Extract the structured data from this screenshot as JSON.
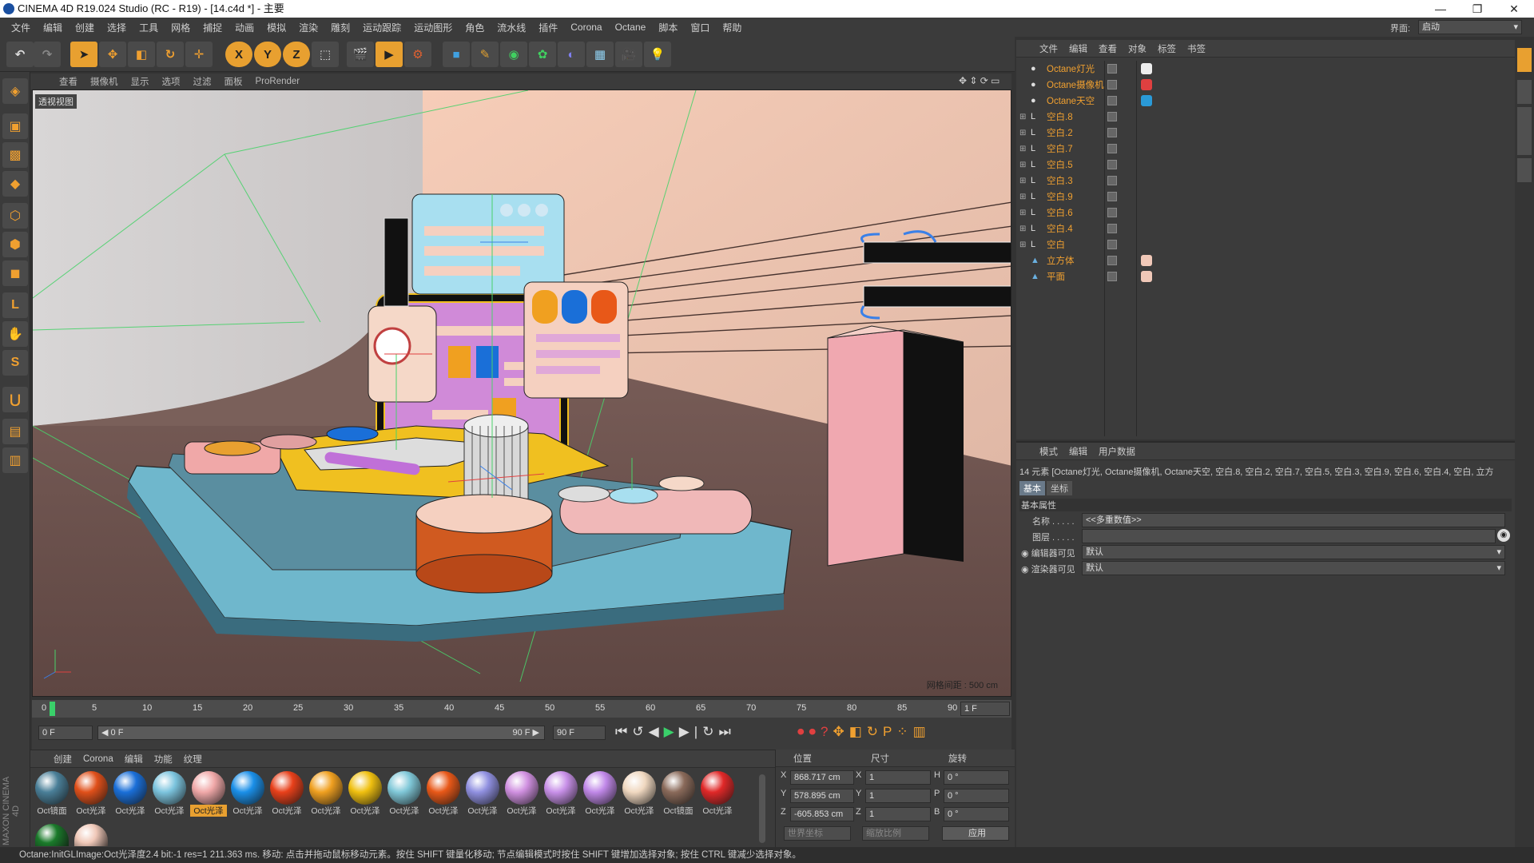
{
  "window": {
    "title": "CINEMA 4D R19.024 Studio (RC - R19) - [14.c4d *] - 主要",
    "controls": [
      "—",
      "❐",
      "✕"
    ]
  },
  "menu": [
    "文件",
    "编辑",
    "创建",
    "选择",
    "工具",
    "网格",
    "捕捉",
    "动画",
    "模拟",
    "渲染",
    "雕刻",
    "运动跟踪",
    "运动图形",
    "角色",
    "流水线",
    "插件",
    "Corona",
    "Octane",
    "脚本",
    "窗口",
    "帮助"
  ],
  "layout": {
    "label": "界面:",
    "value": "启动"
  },
  "viewport": {
    "menu": [
      "查看",
      "摄像机",
      "显示",
      "选项",
      "过滤",
      "面板",
      "ProRender"
    ],
    "label": "透视视图",
    "grid_text": "网格间距 : 500 cm"
  },
  "timeline": {
    "ticks": [
      "0",
      "5",
      "10",
      "15",
      "20",
      "25",
      "30",
      "35",
      "40",
      "45",
      "50",
      "55",
      "60",
      "65",
      "70",
      "75",
      "80",
      "85",
      "90"
    ],
    "current": "1 F",
    "start": "0 F",
    "range_start": "◀ 0 F",
    "range_end": "90 F ▶",
    "end": "90 F"
  },
  "objects": {
    "menu": [
      "文件",
      "编辑",
      "查看",
      "对象",
      "标签",
      "书签"
    ],
    "items": [
      {
        "name": "Octane灯光"
      },
      {
        "name": "Octane摄像机"
      },
      {
        "name": "Octane天空"
      },
      {
        "name": "空白.8"
      },
      {
        "name": "空白.2"
      },
      {
        "name": "空白.7"
      },
      {
        "name": "空白.5"
      },
      {
        "name": "空白.3"
      },
      {
        "name": "空白.9"
      },
      {
        "name": "空白.6"
      },
      {
        "name": "空白.4"
      },
      {
        "name": "空白"
      },
      {
        "name": "立方体"
      },
      {
        "name": "平面"
      }
    ]
  },
  "attributes": {
    "menu": [
      "模式",
      "编辑",
      "用户数据"
    ],
    "summary": "14 元素 [Octane灯光, Octane摄像机, Octane天空, 空白.8, 空白.2, 空白.7, 空白.5, 空白.3, 空白.9, 空白.6, 空白.4, 空白, 立方",
    "tabs": [
      "基本",
      "坐标"
    ],
    "section": "基本属性",
    "name_label": "名称 . . . . .",
    "name_value": "<<多重数值>>",
    "layer_label": "图层 . . . . .",
    "editor_vis_label": "编辑器可见",
    "editor_vis_value": "默认",
    "render_vis_label": "渲染器可见",
    "render_vis_value": "默认"
  },
  "materials": {
    "menu": [
      "创建",
      "Corona",
      "编辑",
      "功能",
      "纹理"
    ],
    "items": [
      {
        "label": "Oct镜面",
        "color": "#4a7f98"
      },
      {
        "label": "Oct光泽",
        "color": "#e0501a"
      },
      {
        "label": "Oct光泽",
        "color": "#1a6fd8"
      },
      {
        "label": "Oct光泽",
        "color": "#7cc4de"
      },
      {
        "label": "Oct光泽",
        "color": "#f0a8a8"
      },
      {
        "label": "Oct光泽",
        "color": "#1a8fe8"
      },
      {
        "label": "Oct光泽",
        "color": "#e8401a"
      },
      {
        "label": "Oct光泽",
        "color": "#f0a020"
      },
      {
        "label": "Oct光泽",
        "color": "#f0c010"
      },
      {
        "label": "Oct光泽",
        "color": "#80c8d8"
      },
      {
        "label": "Oct光泽",
        "color": "#e85818"
      },
      {
        "label": "Oct光泽",
        "color": "#9090e0"
      },
      {
        "label": "Oct光泽",
        "color": "#d090e0"
      },
      {
        "label": "Oct光泽",
        "color": "#c890e8"
      },
      {
        "label": "Oct光泽",
        "color": "#c088e8"
      },
      {
        "label": "Oct光泽",
        "color": "#f0d8c0"
      },
      {
        "label": "Oct镜面",
        "color": "#8a6a5a"
      },
      {
        "label": "Oct光泽",
        "color": "#e02828"
      }
    ],
    "row2": [
      {
        "color": "#1a7a2a"
      },
      {
        "color": "#f0c8b8"
      }
    ]
  },
  "coords": {
    "headers": [
      "位置",
      "尺寸",
      "旋转"
    ],
    "rows": [
      {
        "axis": "X",
        "pos": "868.717 cm",
        "size_axis": "X",
        "size": "1",
        "rot_axis": "H",
        "rot": "0 °"
      },
      {
        "axis": "Y",
        "pos": "578.895 cm",
        "size_axis": "Y",
        "size": "1",
        "rot_axis": "P",
        "rot": "0 °"
      },
      {
        "axis": "Z",
        "pos": "-605.853 cm",
        "size_axis": "Z",
        "size": "1",
        "rot_axis": "B",
        "rot": "0 °"
      }
    ],
    "mode1": "世界坐标",
    "mode2": "缩放比例",
    "apply": "应用"
  },
  "status": "Octane:InitGLImage:Oct光泽度2.4  bit:-1 res=1  211.363 ms.        移动: 点击并拖动鼠标移动元素。按住 SHIFT 键量化移动; 节点编辑模式时按住 SHIFT 键增加选择对象; 按住 CTRL 键减少选择对象。",
  "brand": "MAXON CINEMA 4D"
}
